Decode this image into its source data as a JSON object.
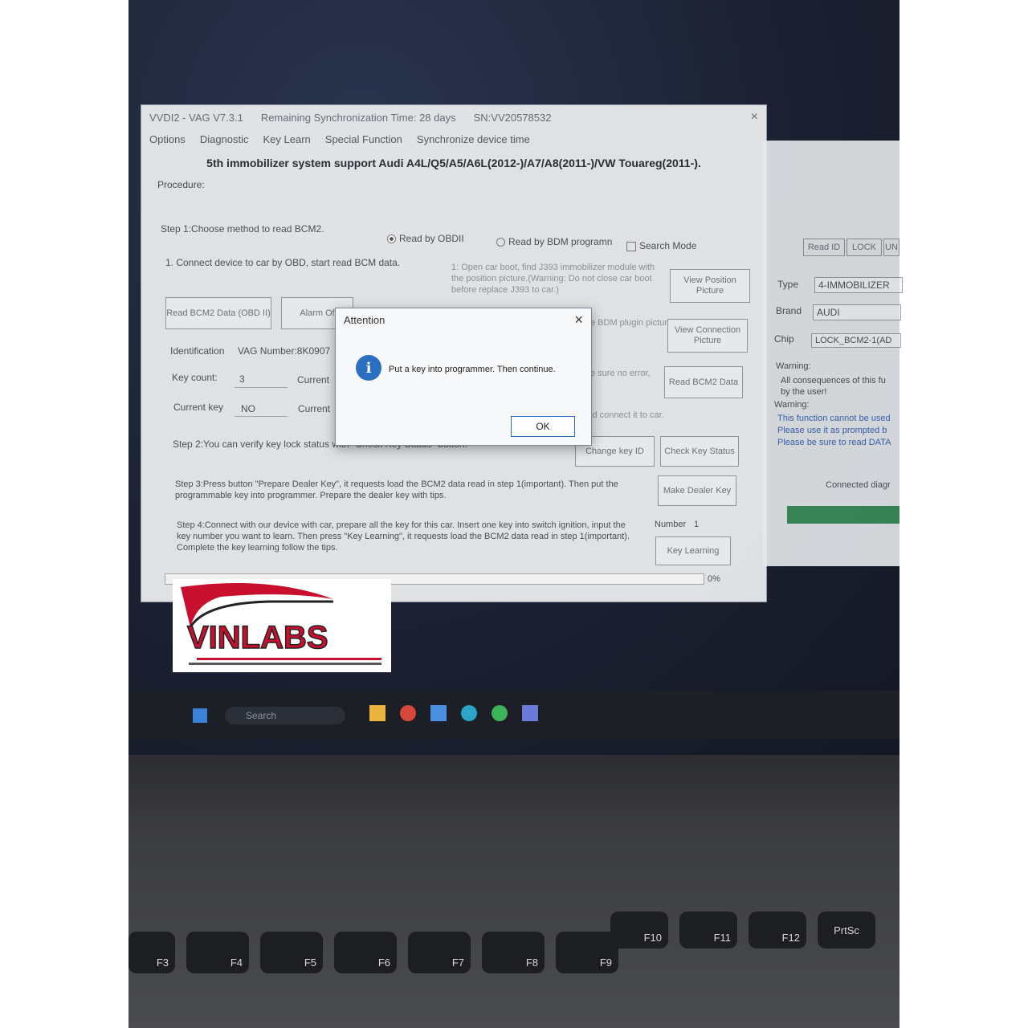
{
  "window": {
    "title": "VVDI2 - VAG V7.3.1",
    "sync_time": "Remaining Synchronization Time: 28 days",
    "serial": "SN:VV20578532",
    "menu": [
      "Options",
      "Diagnostic",
      "Key Learn",
      "Special Function",
      "Synchronize device time"
    ],
    "heading": "5th immobilizer system support Audi A4L/Q5/A5/A6L(2012-)/A7/A8(2011-)/VW Touareg(2011-)."
  },
  "procedure": {
    "label": "Procedure:",
    "step1": "Step 1:Choose method to read BCM2.",
    "radio_obd": "Read by OBDII",
    "radio_bdm": "Read by BDM programn",
    "search_mode": "Search Mode",
    "obd_text": "1. Connect device to car by OBD, start read BCM data.",
    "bdm_text": "1: Open car boot, find J393 immobilizer module with the position picture.(Warning: Do not close car boot before replace J393 to car.)",
    "bdm_text2": "e BDM plugin picture and",
    "bdm_text3": "e sure no error,",
    "bdm_text4": "id connect it to car.",
    "btn_read_bcm2_obd": "Read BCM2 Data (OBD II)",
    "btn_alarm": "Alarm Of",
    "btn_view_position": "View Position Picture",
    "btn_view_connection": "View Connection Picture",
    "btn_read_bcm2": "Read BCM2 Data",
    "identification_label": "Identification",
    "vag_number": "VAG Number:8K0907",
    "key_count_label": "Key count:",
    "key_count": "3",
    "current_label_1": "Current",
    "current_key_label": "Current key",
    "current_key": "NO",
    "current_label_2": "Current",
    "step2": "Step 2:You can verify key lock status with \"Check Key Status\" button.",
    "btn_change_key_id": "Change key ID",
    "btn_check_key_status": "Check Key Status",
    "step3": "Step 3:Press button \"Prepare Dealer Key\", it requests load the BCM2 data read in step 1(important). Then put the programmable key into programmer. Prepare the dealer key with tips.",
    "btn_make_dealer_key": "Make Dealer Key",
    "step4": "Step 4:Connect with our device with car, prepare all the key for this car. Insert one key into switch ignition, input the key number you want to learn. Then press \"Key Learning\", it requests load the BCM2 data read in step 1(important). Complete the key learning follow the tips.",
    "number_label": "Number",
    "number_value": "1",
    "btn_key_learning": "Key Learning",
    "progress": "0%"
  },
  "right_panel": {
    "btn_read_id": "Read ID",
    "btn_lock": "LOCK",
    "btn_unlock": "UN",
    "type_label": "Type",
    "type_value": "4-IMMOBILIZER",
    "brand_label": "Brand",
    "brand_value": "AUDI",
    "chip_label": "Chip",
    "chip_value": "LOCK_BCM2-1(AD",
    "warning1_label": "Warning:",
    "warning1_text": "All consequences of this fu by the user!",
    "warning2_label": "Warning:",
    "warning2_text": "This function cannot be used Please use it as prompted b Please be sure to read DATA",
    "connected": "Connected diagr"
  },
  "dialog": {
    "title": "Attention",
    "message": "Put a key into programmer. Then continue.",
    "ok": "OK"
  },
  "logo": {
    "text": "VINLABS"
  },
  "taskbar": {
    "search": "Search"
  },
  "keyboard": {
    "row1": [
      "F3",
      "F4",
      "F5",
      "F6",
      "F7",
      "F8",
      "F9",
      "F10",
      "F11",
      "F12",
      "PrtSc"
    ]
  },
  "colors": {
    "accent": "#2a6fc0",
    "logo_red": "#c8102e"
  }
}
